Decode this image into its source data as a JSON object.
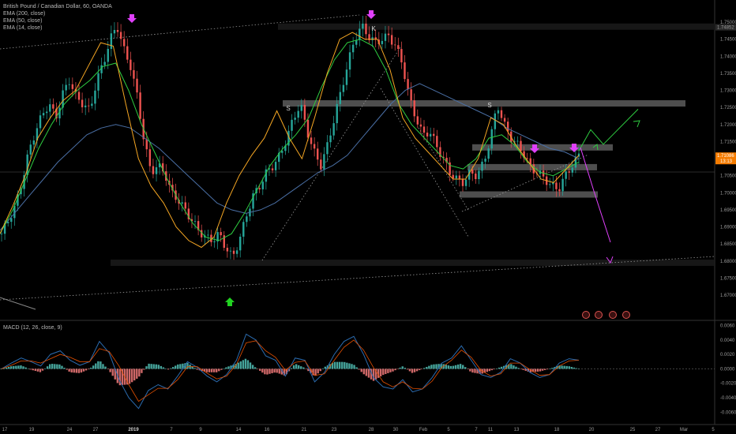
{
  "title": "British Pound / Canadian Dollar, 60, OANDA",
  "indicators": [
    "EMA (200, close)",
    "EMA (50, close)",
    "EMA (14, close)"
  ],
  "macd_title": "MACD (12, 26, close, 9)",
  "colors": {
    "background": "#000000",
    "candle_up": "#26a69a",
    "candle_down": "#ef5350",
    "ema200": "#4a6fa5",
    "ema50": "#2ecc40",
    "ema14": "#f5a623",
    "arrow_magenta": "#e040fb",
    "arrow_green": "#21d321",
    "last_price_tag": "#f57c00",
    "macd_line": "#2b6cb0",
    "signal_line": "#e65100"
  },
  "chart_data": {
    "type": "line",
    "price_axis": {
      "ylim": [
        1.664,
        1.7565
      ],
      "ticks": [
        "1.75000",
        "1.74500",
        "1.74000",
        "1.73500",
        "1.73000",
        "1.72500",
        "1.72000",
        "1.71500",
        "1.71000",
        "1.70500",
        "1.70000",
        "1.69500",
        "1.69000",
        "1.68500",
        "1.68000",
        "1.67500",
        "1.67000"
      ],
      "tick_values": [
        1.75,
        1.745,
        1.74,
        1.735,
        1.73,
        1.725,
        1.72,
        1.715,
        1.71,
        1.705,
        1.7,
        1.695,
        1.69,
        1.685,
        1.68,
        1.675,
        1.67
      ]
    },
    "x_axis": {
      "ticks": [
        "17",
        "19",
        "24",
        "27",
        "2019",
        "7",
        "9",
        "14",
        "16",
        "21",
        "23",
        "28",
        "30",
        "Feb",
        "5",
        "7",
        "11",
        "13",
        "18",
        "20",
        "25",
        "27",
        "Mar",
        "5"
      ]
    },
    "price_labels": {
      "high_marker": "1.74852",
      "last_price": "1.71086",
      "countdown": "13:13"
    },
    "close_series": [
      1.688,
      1.692,
      1.696,
      1.703,
      1.712,
      1.718,
      1.723,
      1.726,
      1.722,
      1.729,
      1.733,
      1.728,
      1.726,
      1.724,
      1.733,
      1.738,
      1.745,
      1.749,
      1.742,
      1.737,
      1.728,
      1.715,
      1.706,
      1.708,
      1.706,
      1.7,
      1.698,
      1.695,
      1.692,
      1.689,
      1.687,
      1.686,
      1.688,
      1.684,
      1.681,
      1.686,
      1.693,
      1.699,
      1.702,
      1.706,
      1.708,
      1.711,
      1.716,
      1.722,
      1.726,
      1.718,
      1.712,
      1.708,
      1.714,
      1.722,
      1.73,
      1.738,
      1.745,
      1.749,
      1.746,
      1.744,
      1.745,
      1.746,
      1.743,
      1.738,
      1.728,
      1.722,
      1.717,
      1.718,
      1.714,
      1.71,
      1.706,
      1.704,
      1.703,
      1.706,
      1.705,
      1.709,
      1.716,
      1.726,
      1.72,
      1.716,
      1.714,
      1.711,
      1.707,
      1.706,
      1.704,
      1.702,
      1.701,
      1.705,
      1.708,
      1.711
    ],
    "ema200_series": [
      1.689,
      1.694,
      1.699,
      1.704,
      1.709,
      1.713,
      1.717,
      1.719,
      1.72,
      1.719,
      1.716,
      1.713,
      1.709,
      1.705,
      1.701,
      1.697,
      1.695,
      1.694,
      1.695,
      1.697,
      1.7,
      1.703,
      1.706,
      1.708,
      1.711,
      1.716,
      1.721,
      1.726,
      1.73,
      1.732,
      1.73,
      1.728,
      1.726,
      1.724,
      1.722,
      1.719,
      1.717,
      1.715,
      1.713,
      1.712,
      1.71
    ],
    "ema50_series": [
      1.688,
      1.695,
      1.704,
      1.713,
      1.72,
      1.726,
      1.73,
      1.733,
      1.737,
      1.738,
      1.73,
      1.72,
      1.712,
      1.704,
      1.697,
      1.691,
      1.687,
      1.686,
      1.688,
      1.694,
      1.701,
      1.708,
      1.713,
      1.717,
      1.722,
      1.731,
      1.739,
      1.744,
      1.745,
      1.743,
      1.736,
      1.726,
      1.72,
      1.716,
      1.712,
      1.708,
      1.707,
      1.71,
      1.716,
      1.717,
      1.714,
      1.709,
      1.706,
      1.705,
      1.707,
      1.709
    ],
    "ema14_series": [
      1.688,
      1.696,
      1.705,
      1.716,
      1.722,
      1.727,
      1.73,
      1.737,
      1.744,
      1.743,
      1.726,
      1.71,
      1.702,
      1.697,
      1.69,
      1.686,
      1.684,
      1.687,
      1.697,
      1.705,
      1.711,
      1.716,
      1.724,
      1.716,
      1.71,
      1.722,
      1.735,
      1.745,
      1.747,
      1.745,
      1.745,
      1.736,
      1.722,
      1.716,
      1.712,
      1.708,
      1.704,
      1.704,
      1.71,
      1.722,
      1.72,
      1.714,
      1.709,
      1.704,
      1.703,
      1.707,
      1.711
    ],
    "annotations": {
      "pattern_labels": [
        "S",
        "K",
        "S"
      ],
      "resistance_zones": [
        1.7487,
        1.7262,
        1.7133,
        1.7075,
        1.6995,
        1.6795
      ],
      "forecast_bull": [
        1.7123,
        1.7185,
        1.7142,
        1.7245
      ],
      "forecast_bear": [
        1.7133,
        1.7005,
        1.6855
      ]
    },
    "macd": {
      "axis_ticks": [
        "0.0060",
        "0.0040",
        "0.0020",
        "0.0000",
        "-0.0020",
        "-0.0040",
        "-0.0060"
      ],
      "tick_values": [
        0.006,
        0.004,
        0.002,
        0,
        -0.002,
        -0.004,
        -0.006
      ],
      "ylim": [
        -0.0075,
        0.0065
      ],
      "macd_series": [
        0,
        0.0008,
        0.0015,
        0.001,
        0.0004,
        0.002,
        0.0025,
        0.0012,
        0.0005,
        0.001,
        0.0038,
        0.0022,
        -0.0015,
        -0.004,
        -0.0055,
        -0.003,
        -0.0022,
        -0.0028,
        -0.001,
        0.001,
        0.0002,
        -0.001,
        -0.0018,
        -0.0008,
        0.0012,
        0.0048,
        0.004,
        0.0018,
        0.0012,
        -0.001,
        0.0015,
        0.0012,
        -0.0018,
        -0.0005,
        0.002,
        0.0038,
        0.0045,
        0.002,
        -0.0012,
        -0.0025,
        -0.0028,
        -0.0015,
        -0.0032,
        -0.0028,
        -0.0012,
        0.0008,
        0.0015,
        0.0032,
        0.0012,
        -0.0008,
        -0.0012,
        -0.0005,
        0.0014,
        0.0008,
        -0.0005,
        -0.0012,
        -0.0008,
        0.0008,
        0.0014,
        0.0012
      ],
      "signal_series": [
        0,
        0.0005,
        0.0011,
        0.0011,
        0.0008,
        0.0014,
        0.002,
        0.0016,
        0.001,
        0.001,
        0.0028,
        0.0024,
        0.0004,
        -0.0022,
        -0.0045,
        -0.0036,
        -0.0027,
        -0.0027,
        -0.0015,
        0.0003,
        0.0003,
        -0.0006,
        -0.0014,
        -0.001,
        0.0006,
        0.0036,
        0.0039,
        0.0025,
        0.0016,
        -0.0002,
        0.0009,
        0.0011,
        -0.0009,
        -0.0007,
        0.0012,
        0.003,
        0.004,
        0.0026,
        0.0002,
        -0.0018,
        -0.0025,
        -0.0018,
        -0.0027,
        -0.0028,
        -0.0017,
        0.0002,
        0.0012,
        0.0026,
        0.0016,
        -0.0002,
        -0.001,
        -0.0007,
        0.0008,
        0.0008,
        -0.0001,
        -0.0009,
        -0.0008,
        0.0004,
        0.0011,
        0.0012
      ]
    }
  }
}
